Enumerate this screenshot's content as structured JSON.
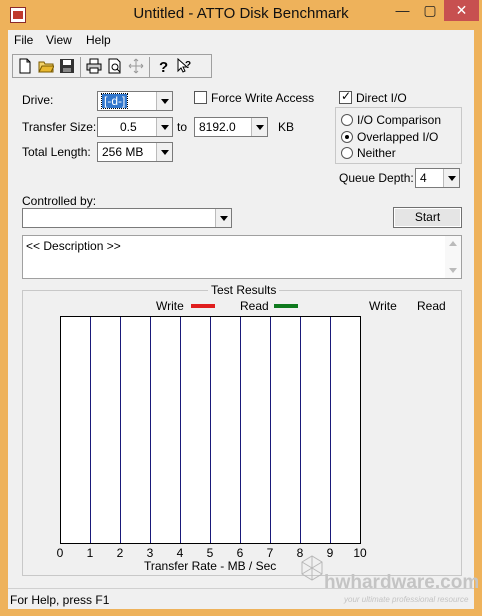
{
  "window": {
    "title": "Untitled - ATTO Disk Benchmark",
    "minimize_glyph": "—",
    "maximize_glyph": "▢",
    "close_glyph": "✕"
  },
  "menu": [
    "File",
    "View",
    "Help"
  ],
  "toolbar": {
    "icons": [
      "new-document-icon",
      "open-folder-icon",
      "save-icon",
      "print-icon",
      "print-preview-icon",
      "move-icon",
      "help-icon",
      "context-help-icon"
    ]
  },
  "form": {
    "drive_label": "Drive:",
    "drive_value": "[-d-]",
    "transfer_size_label": "Transfer Size:",
    "transfer_from": "0.5",
    "to_label": "to",
    "transfer_to": "8192.0",
    "kb_label": "KB",
    "total_length_label": "Total Length:",
    "total_length_value": "256 MB",
    "force_write_label": "Force Write Access",
    "force_write_checked": false,
    "direct_io_label": "Direct I/O",
    "direct_io_checked": true,
    "radio_options": [
      "I/O Comparison",
      "Overlapped I/O",
      "Neither"
    ],
    "radio_selected": "Overlapped I/O",
    "queue_depth_label": "Queue Depth:",
    "queue_depth_value": "4",
    "controlled_by_label": "Controlled by:",
    "controlled_by_value": "",
    "start_label": "Start",
    "description": "<< Description >>"
  },
  "results": {
    "title": "Test Results",
    "write_legend": "Write",
    "read_legend": "Read",
    "write_color": "#e01e1e",
    "read_color": "#0f7a1e",
    "write_col_header": "Write",
    "read_col_header": "Read",
    "x_ticks": [
      "0",
      "1",
      "2",
      "3",
      "4",
      "5",
      "6",
      "7",
      "8",
      "9",
      "10"
    ],
    "x_axis_label": "Transfer Rate - MB / Sec"
  },
  "status": {
    "text": "For Help, press F1"
  },
  "watermark": {
    "brand": "hwhardware.com",
    "tagline": "your ultimate professional resource"
  }
}
